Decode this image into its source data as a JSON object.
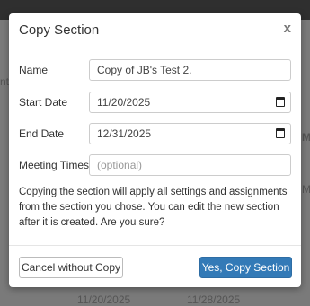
{
  "modal": {
    "title": "Copy Section",
    "close_glyph": "x"
  },
  "form": {
    "name_label": "Name",
    "name_value": "Copy of JB's Test 2.",
    "start_label": "Start Date",
    "start_value": "11/20/2025",
    "end_label": "End Date",
    "end_value": "12/31/2025",
    "meeting_label": "Meeting Times",
    "meeting_placeholder": "(optional)"
  },
  "description": "Copying the section will apply all settings and assignments from the section you chose. You can edit the new section after it is created. Are you sure?",
  "buttons": {
    "cancel": "Cancel without Copy",
    "confirm": "Yes, Copy Section"
  },
  "backdrop": {
    "left_fragment": "nte",
    "right_fragment_1": "Me",
    "right_fragment_2": "M,",
    "bottom_date_1": "11/20/2025",
    "bottom_date_2": "11/28/2025"
  },
  "colors": {
    "primary": "#337ab7",
    "overlay": "#7a7a7a"
  }
}
